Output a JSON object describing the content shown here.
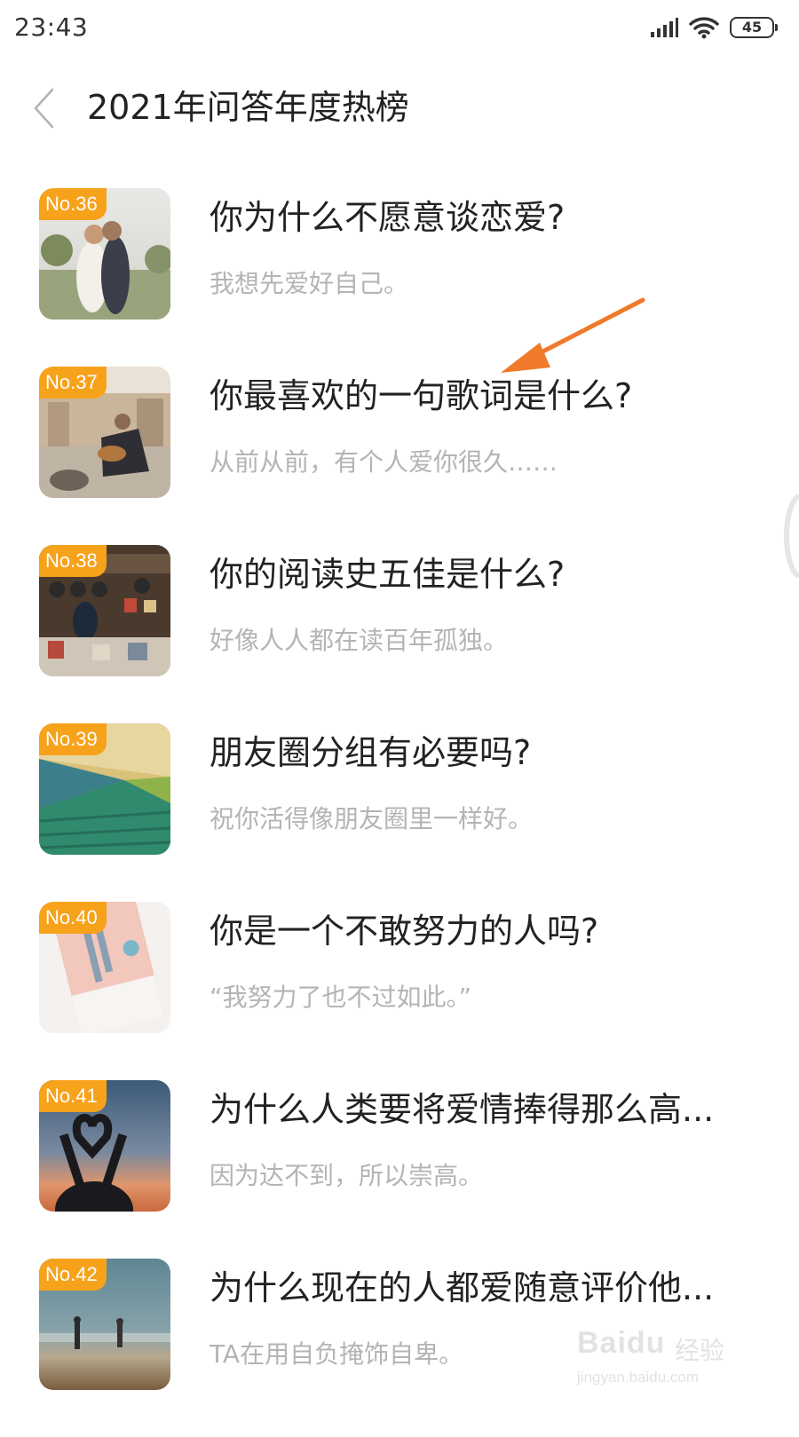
{
  "status_bar": {
    "time": "23:43",
    "battery_level": "45",
    "icons": [
      "signal-icon",
      "wifi-icon",
      "battery-icon"
    ]
  },
  "header": {
    "back_icon": "chevron-left-icon",
    "title": "2021年问答年度热榜"
  },
  "list": {
    "items": [
      {
        "rank": "No.36",
        "title": "你为什么不愿意谈恋爱?",
        "subtitle": "我想先爱好自己。",
        "thumbnail": "couple-photo"
      },
      {
        "rank": "No.37",
        "title": "你最喜欢的一句歌词是什么?",
        "subtitle": "从前从前，有个人爱你很久……",
        "thumbnail": "guitar-player-photo"
      },
      {
        "rank": "No.38",
        "title": "你的阅读史五佳是什么?",
        "subtitle": "好像人人都在读百年孤独。",
        "thumbnail": "record-store-photo"
      },
      {
        "rank": "No.39",
        "title": "朋友圈分组有必要吗?",
        "subtitle": "祝你活得像朋友圈里一样好。",
        "thumbnail": "staircase-photo"
      },
      {
        "rank": "No.40",
        "title": "你是一个不敢努力的人吗?",
        "subtitle": "“我努力了也不过如此。”",
        "thumbnail": "book-cover-photo"
      },
      {
        "rank": "No.41",
        "title": "为什么人类要将爱情捧得那么高...",
        "subtitle": "因为达不到，所以崇高。",
        "thumbnail": "heart-hands-photo"
      },
      {
        "rank": "No.42",
        "title": "为什么现在的人都爱随意评价他...",
        "subtitle": "TA在用自负掩饰自卑。",
        "thumbnail": "beach-photo"
      }
    ]
  },
  "colors": {
    "badge": "#f7a21b",
    "arrow": "#f07a2a",
    "title_text": "#222222",
    "subtitle_text": "#b4b4b4"
  },
  "watermark": {
    "logo": "Baidu",
    "name": "经验",
    "url": "jingyan.baidu.com"
  }
}
